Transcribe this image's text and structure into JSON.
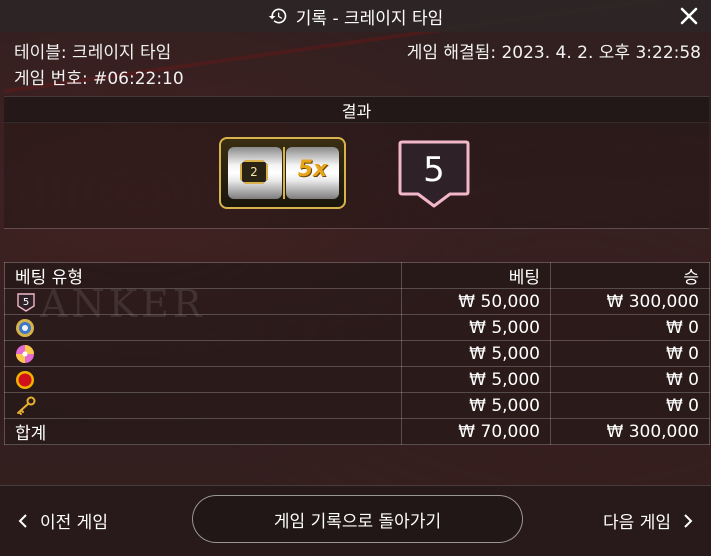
{
  "header": {
    "title": "기록 - 크레이지 타임"
  },
  "info": {
    "table": "테이블: 크레이지 타임",
    "game_number": "게임 번호: #06:22:10",
    "resolved": "게임 해결됨: 2023. 4. 2. 오후 3:22:58"
  },
  "result": {
    "section_title": "결과",
    "slot_segment": "2",
    "slot_multiplier": "5x",
    "outcome": "5"
  },
  "bets_table": {
    "headers": [
      "베팅 유형",
      "베팅",
      "승"
    ],
    "rows": [
      {
        "type_icon": "number-5-icon",
        "type_text": "5",
        "bet": "₩ 50,000",
        "win": "₩ 300,000"
      },
      {
        "type_icon": "coin-flip-icon",
        "bet": "₩ 5,000",
        "win": "₩ 0"
      },
      {
        "type_icon": "pachinko-icon",
        "bet": "₩ 5,000",
        "win": "₩ 0"
      },
      {
        "type_icon": "cash-hunt-icon",
        "bet": "₩ 5,000",
        "win": "₩ 0"
      },
      {
        "type_icon": "crazy-time-key-icon",
        "bet": "₩ 5,000",
        "win": "₩ 0"
      }
    ],
    "total": {
      "label": "합계",
      "bet": "₩ 70,000",
      "win": "₩ 300,000"
    }
  },
  "footer": {
    "prev_label": "이전 게임",
    "back_label": "게임 기록으로 돌아가기",
    "next_label": "다음 게임"
  },
  "colors": {
    "gold": "#d8b24a",
    "pink_border": "#f2b7c8"
  }
}
